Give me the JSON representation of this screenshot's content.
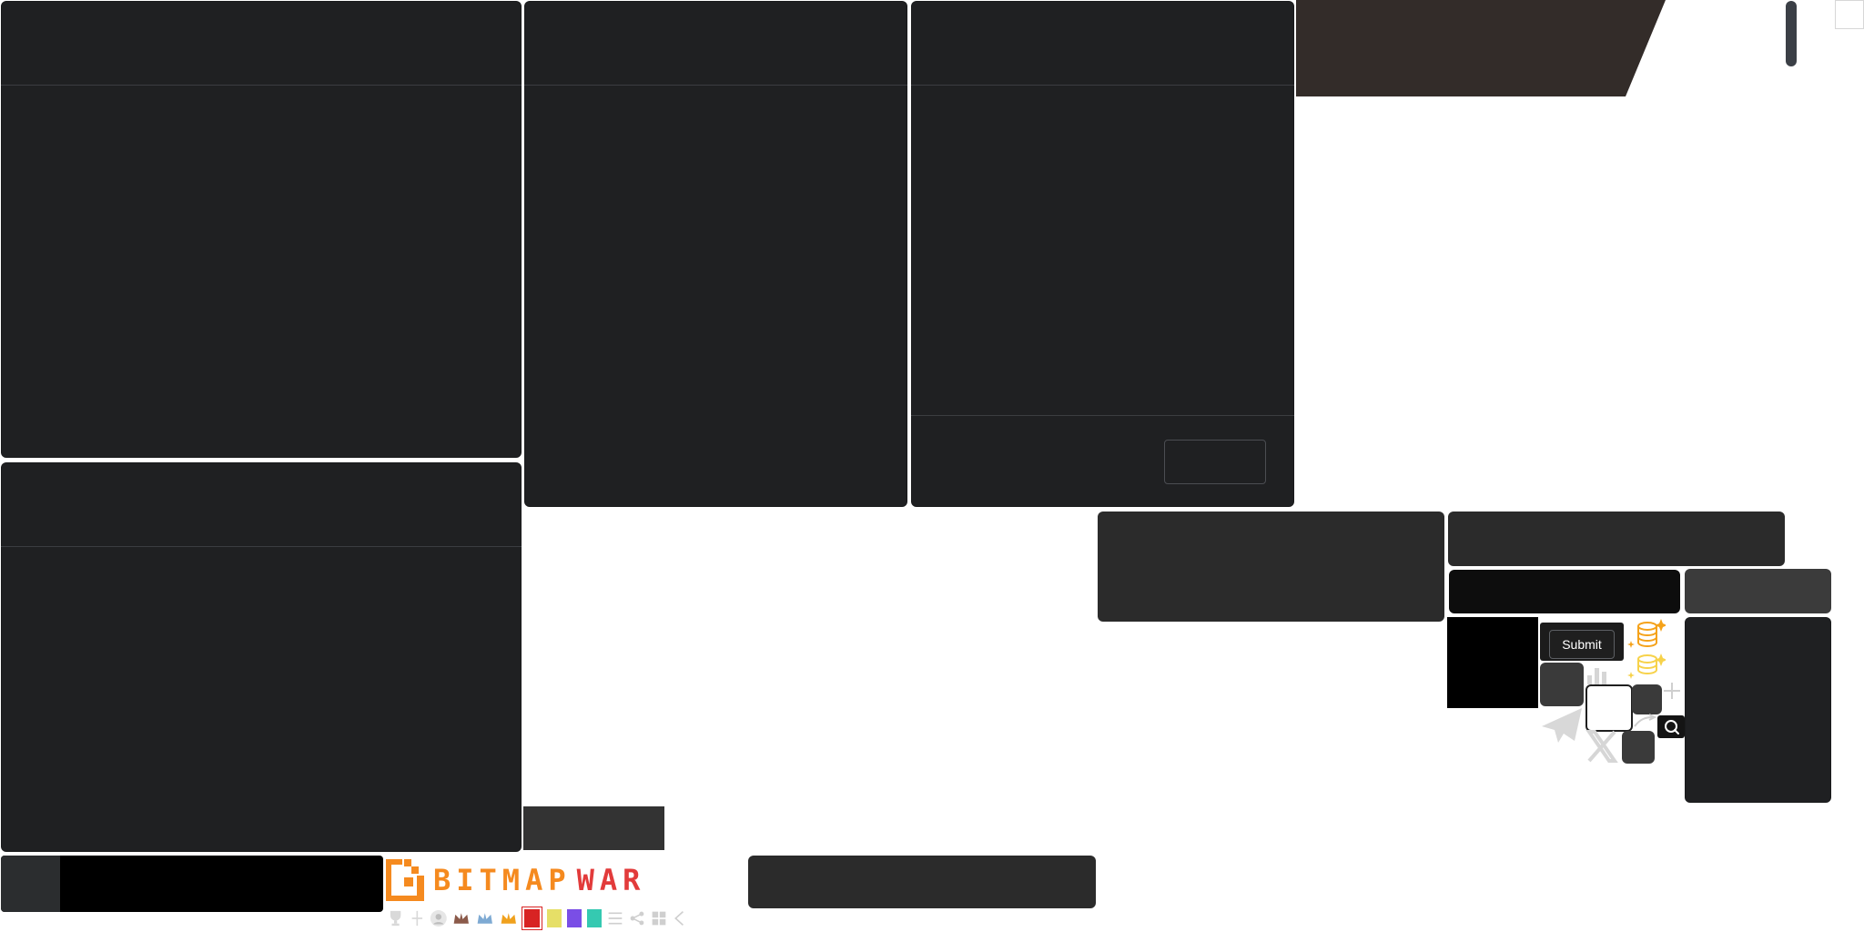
{
  "sprite": {
    "submit_label": "Submit",
    "logo_brand": "BITMAP",
    "logo_suffix": "WAR"
  },
  "colors": {
    "panel": "#1f2022",
    "brown": "#332c29",
    "orange": "#f58a1f",
    "red": "#e23b3b",
    "yellow": "#e6df67",
    "purple": "#7a4ee6",
    "teal": "#35c9b1"
  },
  "icons": [
    "trophy-icon",
    "move-icon",
    "avatar-icon",
    "crown-bronze-icon",
    "crown-silver-icon",
    "crown-gold-icon",
    "swatch-red",
    "swatch-yellow",
    "swatch-purple",
    "swatch-teal",
    "list-icon",
    "share-icon",
    "grid-icon",
    "chevron-left-icon",
    "coins-orange-icon",
    "coins-yellow-icon",
    "bar-chart-icon",
    "plus-icon",
    "arrow-right-icon",
    "paper-plane-icon",
    "x-icon",
    "search-icon"
  ]
}
